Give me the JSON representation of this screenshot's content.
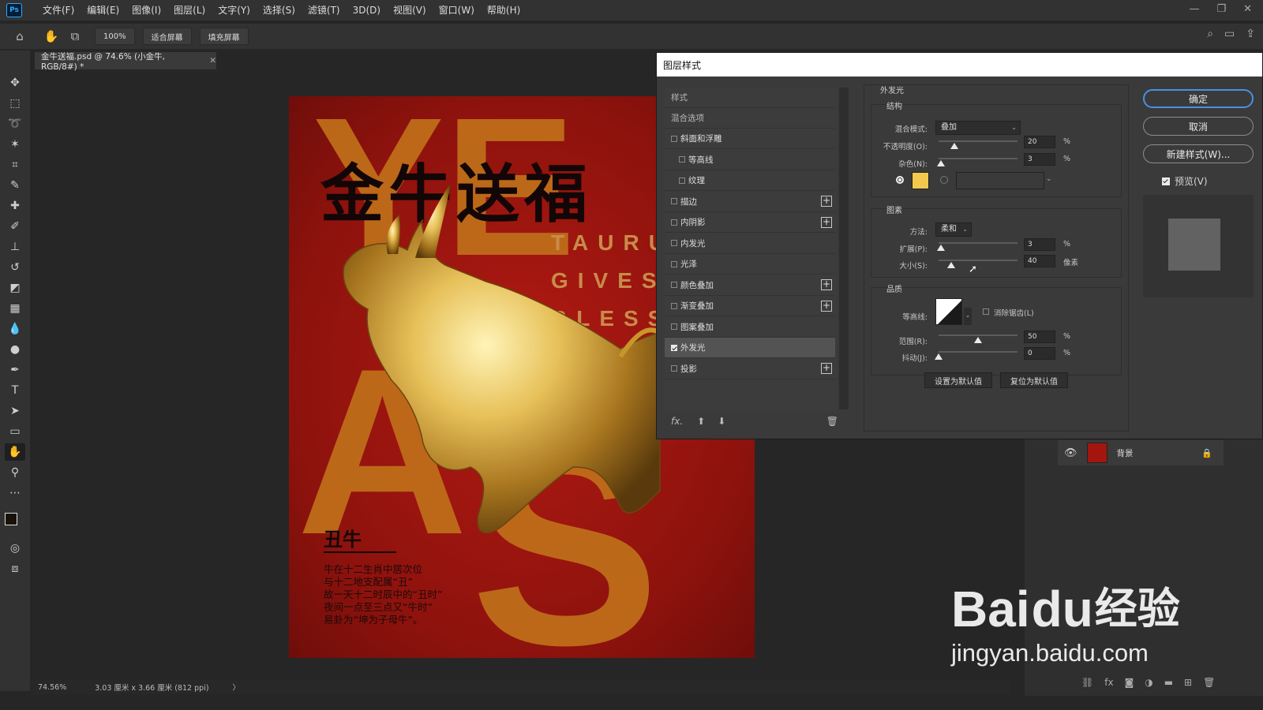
{
  "app": {
    "logo": "Ps"
  },
  "menu": [
    "文件(F)",
    "编辑(E)",
    "图像(I)",
    "图层(L)",
    "文字(Y)",
    "选择(S)",
    "滤镜(T)",
    "3D(D)",
    "视图(V)",
    "窗口(W)",
    "帮助(H)"
  ],
  "options": {
    "zoom_btn": "100%",
    "fit_btn": "适合屏幕",
    "fill_btn": "填充屏幕"
  },
  "document": {
    "tab_title": "金牛送福.psd @ 74.6% (小金牛, RGB/8#) *",
    "close": "✕"
  },
  "poster": {
    "title": "金牛送福",
    "en_lines": [
      "TAURUS",
      "GIVES",
      "BLESSI"
    ],
    "bg_letters": [
      "YE",
      "A",
      "S"
    ],
    "subhead": "丑牛",
    "body": [
      "牛在十二生肖中居次位",
      "与十二地支配属“丑”",
      "故一天十二时辰中的“丑时”",
      "夜间一点至三点又“牛时”",
      "易卦为“坤为子母牛”。"
    ]
  },
  "status": {
    "zoom": "74.56%",
    "docsize": "3.03 厘米 x 3.66 厘米 (812 ppi)",
    "arrow": "〉"
  },
  "layers": {
    "background_name": "背景"
  },
  "dialog": {
    "title": "图层样式",
    "list_header": "样式",
    "list_blend": "混合选项",
    "styles": [
      {
        "label": "斜面和浮雕",
        "checked": false,
        "indent": false,
        "plus": false
      },
      {
        "label": "等高线",
        "checked": false,
        "indent": true,
        "plus": false
      },
      {
        "label": "纹理",
        "checked": false,
        "indent": true,
        "plus": false
      },
      {
        "label": "描边",
        "checked": false,
        "indent": false,
        "plus": true
      },
      {
        "label": "内阴影",
        "checked": false,
        "indent": false,
        "plus": true
      },
      {
        "label": "内发光",
        "checked": false,
        "indent": false,
        "plus": false
      },
      {
        "label": "光泽",
        "checked": false,
        "indent": false,
        "plus": false
      },
      {
        "label": "颜色叠加",
        "checked": false,
        "indent": false,
        "plus": true
      },
      {
        "label": "渐变叠加",
        "checked": false,
        "indent": false,
        "plus": true
      },
      {
        "label": "图案叠加",
        "checked": false,
        "indent": false,
        "plus": false
      },
      {
        "label": "外发光",
        "checked": true,
        "indent": false,
        "plus": false
      },
      {
        "label": "投影",
        "checked": false,
        "indent": false,
        "plus": true
      }
    ],
    "footer_fx": "fx.",
    "section_title": "外发光",
    "structure": {
      "title": "结构",
      "blend_label": "混合模式:",
      "blend_value": "叠加",
      "opacity_label": "不透明度(O):",
      "opacity_value": "20",
      "opacity_unit": "%",
      "opacity_level": 0.2,
      "noise_label": "杂色(N):",
      "noise_value": "3",
      "noise_unit": "%",
      "noise_level": 0.03,
      "color": "#f2c94c"
    },
    "elements": {
      "title": "图素",
      "method_label": "方法:",
      "method_value": "柔和",
      "spread_label": "扩展(P):",
      "spread_value": "3",
      "spread_unit": "%",
      "spread_level": 0.03,
      "size_label": "大小(S):",
      "size_value": "40",
      "size_unit": "像素",
      "size_level": 0.16
    },
    "quality": {
      "title": "品质",
      "contour_label": "等高线:",
      "antialias_label": "消除锯齿(L)",
      "range_label": "范围(R):",
      "range_value": "50",
      "range_unit": "%",
      "range_level": 0.5,
      "jitter_label": "抖动(J):",
      "jitter_value": "0",
      "jitter_unit": "%",
      "jitter_level": 0.0
    },
    "set_default": "设置为默认值",
    "reset_default": "复位为默认值",
    "ok": "确定",
    "cancel": "取消",
    "new_style": "新建样式(W)...",
    "preview": "预览(V)"
  },
  "watermark": {
    "brand": "Bai",
    "brand2": "经验",
    "url": "jingyan.baidu.com"
  },
  "colors": {
    "accent": "#4a90e2",
    "ps_blue": "#31a8ff",
    "poster_red": "#a3160f",
    "poster_orange": "#c0701a"
  }
}
